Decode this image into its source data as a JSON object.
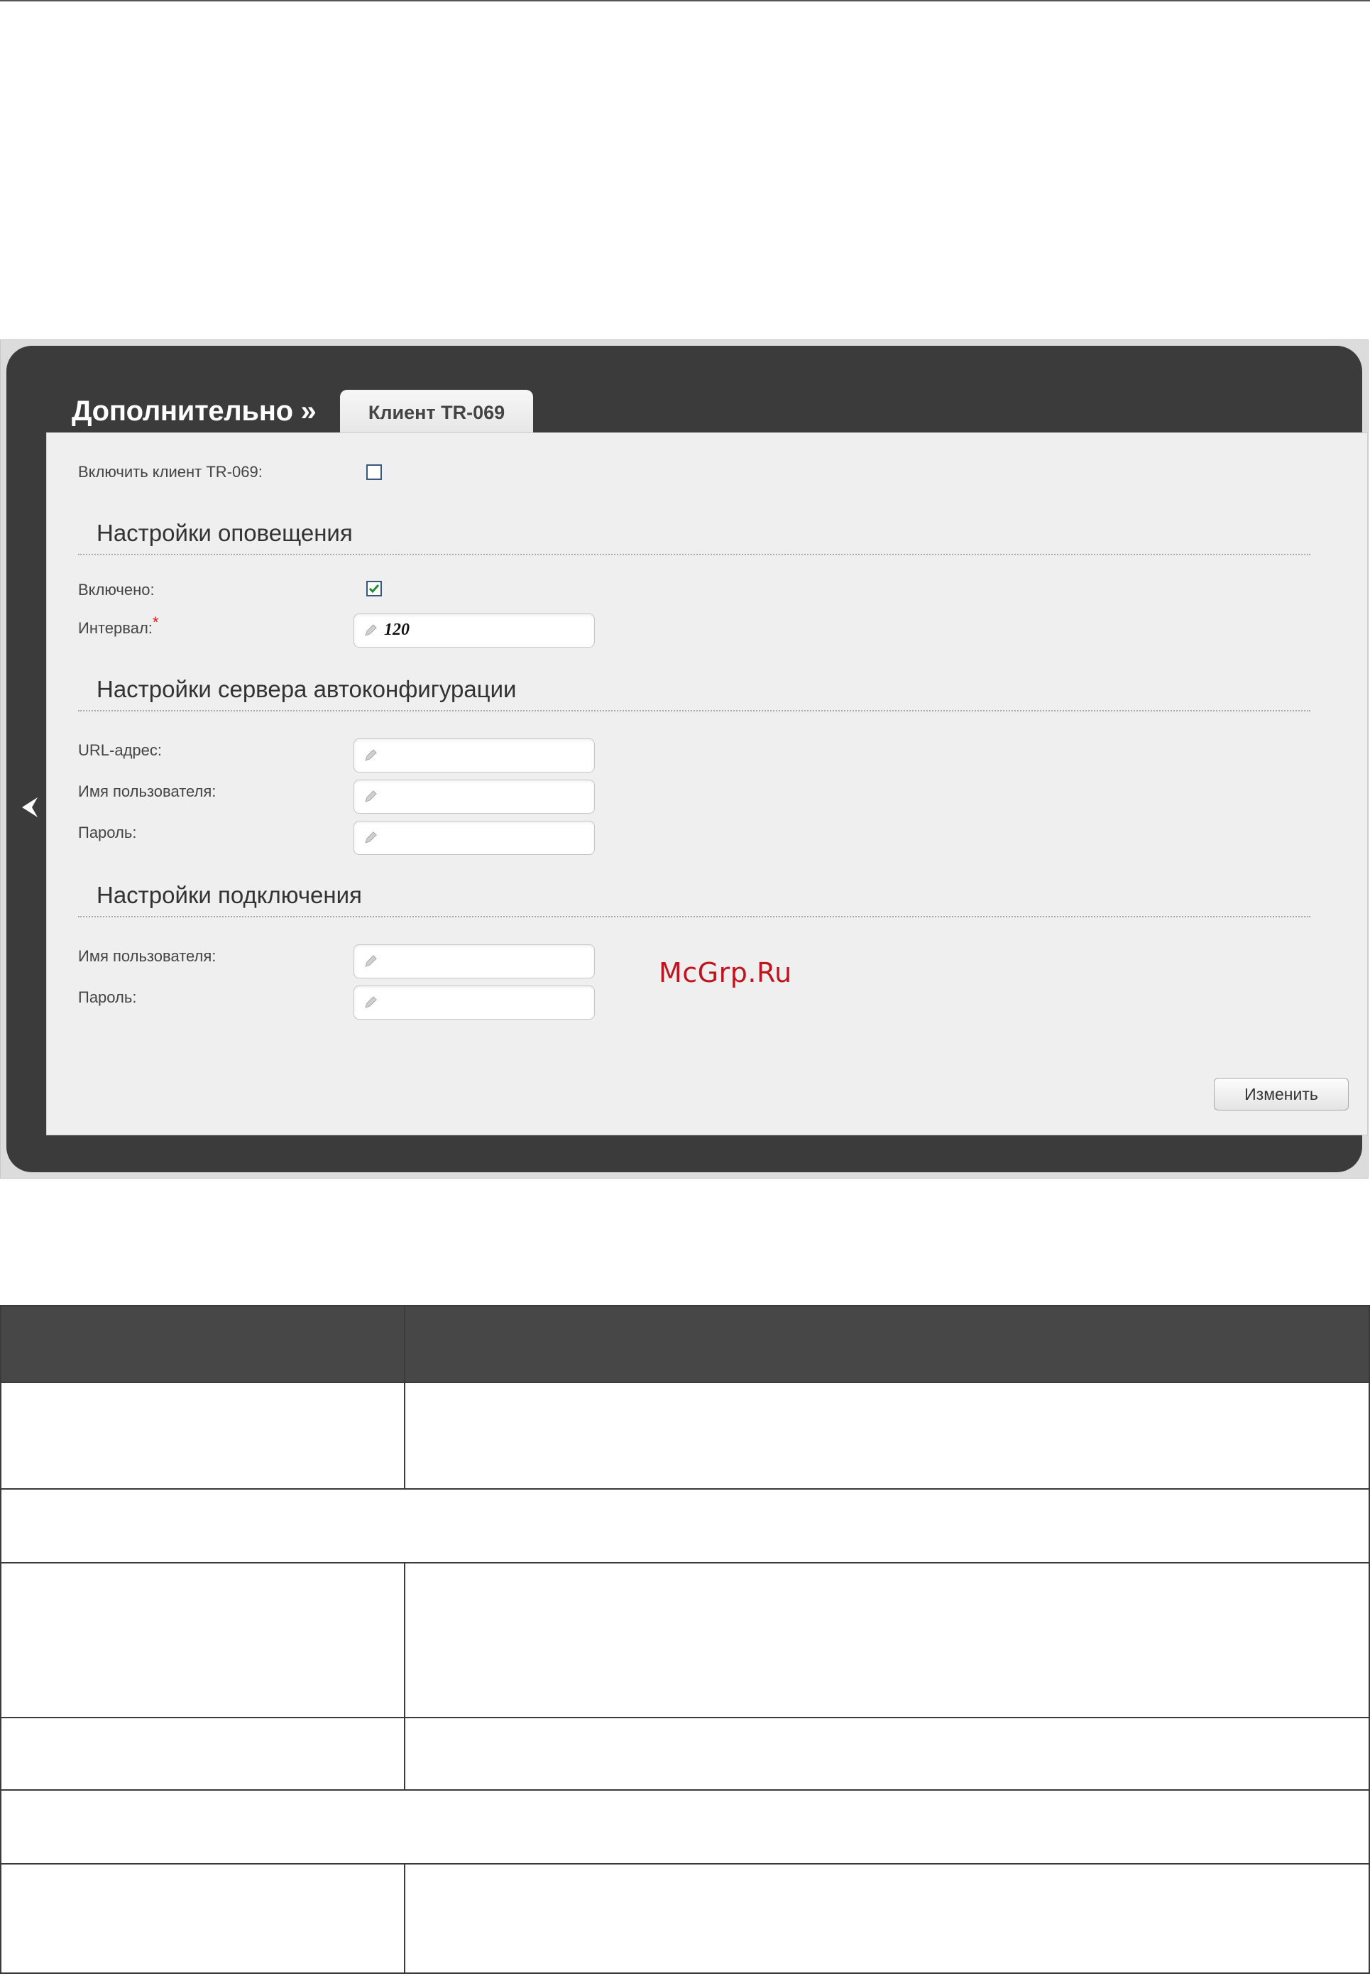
{
  "screen": {
    "heading": "Дополнительно »",
    "tab_label": "Клиент TR-069",
    "enable_client_label": "Включить клиент TR-069:",
    "enable_client_checked": false,
    "sections": {
      "notify": {
        "title": "Настройки оповещения",
        "enabled_label": "Включено:",
        "enabled_checked": true,
        "interval_label": "Интервал:",
        "interval_required_mark": "*",
        "interval_value": "120"
      },
      "acs": {
        "title": "Настройки сервера автоконфигурации",
        "url_label": "URL-адрес:",
        "username_label": "Имя пользователя:",
        "password_label": "Пароль:"
      },
      "connection": {
        "title": "Настройки подключения",
        "username_label": "Имя пользователя:",
        "password_label": "Пароль:"
      }
    },
    "submit_label": "Изменить",
    "watermark": "McGrp.Ru"
  },
  "table": {
    "header": [
      "",
      ""
    ],
    "rows": [
      {
        "type": "pair"
      },
      {
        "type": "span"
      },
      {
        "type": "pair"
      },
      {
        "type": "pair"
      },
      {
        "type": "span"
      },
      {
        "type": "pair"
      }
    ]
  },
  "colors": {
    "panel_dark": "#3b3b3b",
    "content_bg": "#efefef",
    "table_header": "#474747",
    "watermark_red": "#c0141e",
    "checkbox_check": "#1f8f2a"
  },
  "icons": [
    "back-arrow-icon",
    "pencil-icon",
    "checkmark-icon"
  ]
}
